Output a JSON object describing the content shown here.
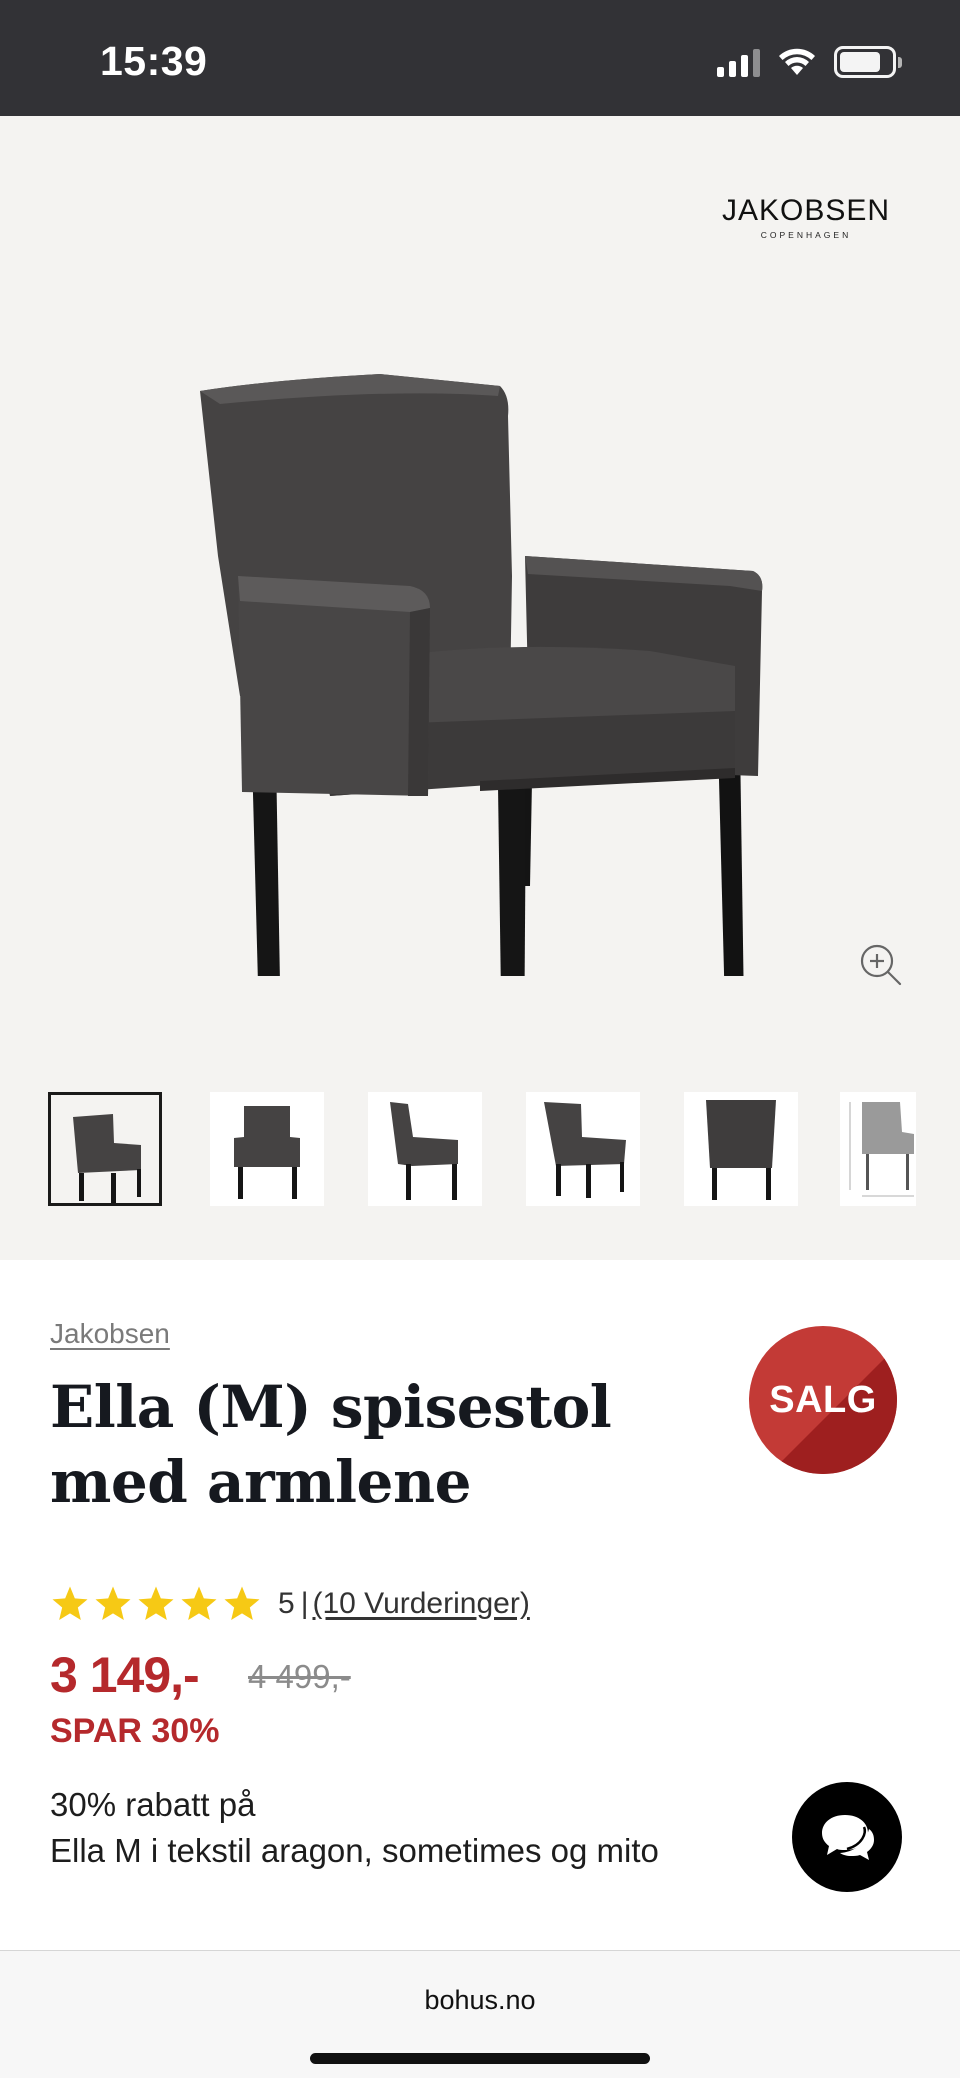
{
  "status_bar": {
    "time": "15:39",
    "icons": [
      "cellular-signal-icon",
      "wifi-icon",
      "battery-icon"
    ]
  },
  "gallery": {
    "brand_logo": {
      "name": "JAKOBSEN",
      "subtitle": "COPENHAGEN"
    },
    "zoom_icon": "zoom-in-icon",
    "thumbnails": [
      "front-angle",
      "front",
      "side",
      "three-quarter",
      "back",
      "dimensions"
    ],
    "active_thumbnail": 0
  },
  "product": {
    "brand": "Jakobsen",
    "title": "Ella (M) spisestol med armlene",
    "badge": "SALG",
    "rating": {
      "stars": 5,
      "value": "5",
      "separator": "|",
      "reviews_link": "(10 Vurderinger)"
    },
    "price_now": "3 149,-",
    "price_old": "4 499,-",
    "save": "SPAR 30%",
    "promo": "30% rabatt på\nElla M i tekstil aragon, sometimes og mito"
  },
  "chat_button": {
    "icon": "chat-bubbles-icon"
  },
  "browser": {
    "url": "bohus.no"
  },
  "colors": {
    "status_bar": "#323236",
    "gallery_bg": "#f4f3f1",
    "sale_red": "#b5292c",
    "star_yellow": "#f6c915",
    "title": "#16191f"
  }
}
